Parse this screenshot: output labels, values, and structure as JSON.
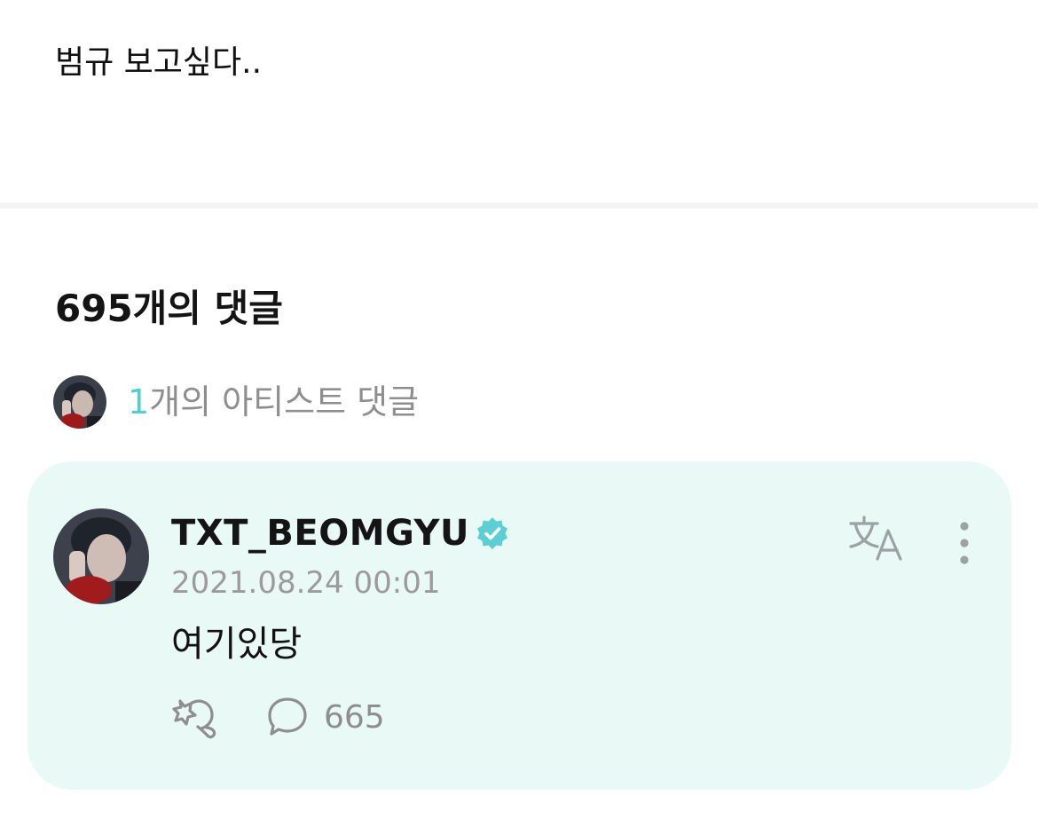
{
  "post": {
    "text": "범규 보고싶다.."
  },
  "comments": {
    "count_label": "695개의 댓글",
    "artist_summary": {
      "number": "1",
      "label": "개의 아티스트 댓글"
    }
  },
  "artist_comment": {
    "author": "TXT_BEOMGYU",
    "timestamp": "2021.08.24 00:01",
    "text": "여기있당",
    "reply_count": "665",
    "verified_icon": "verified-badge-icon",
    "translate_icon": "translate-icon",
    "more_icon": "more-vertical-icon",
    "cheer_icon": "cheer-icon",
    "reply_icon": "comment-bubble-icon"
  },
  "colors": {
    "accent": "#4fd0d0",
    "card_bg": "#e9f9f6",
    "muted_text": "#8e8e8e"
  }
}
